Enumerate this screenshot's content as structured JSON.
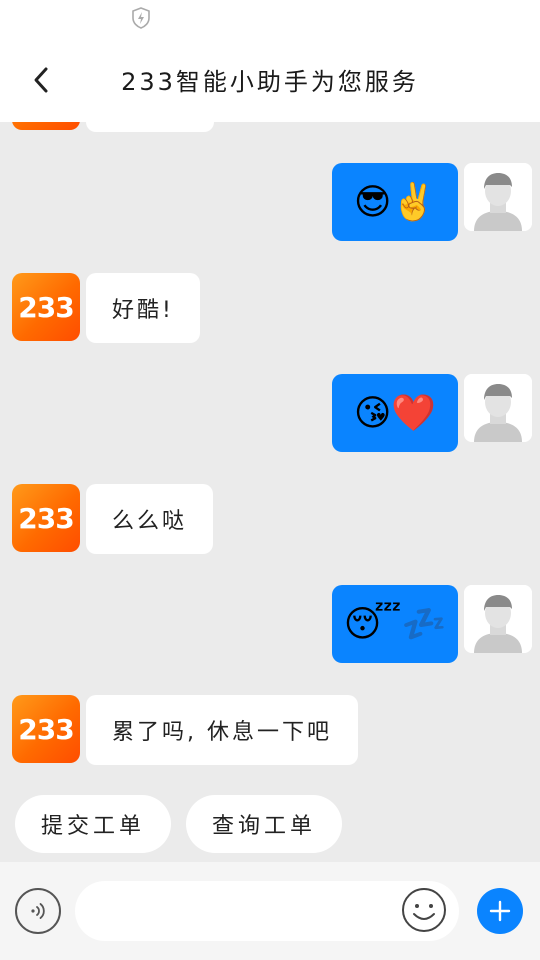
{
  "status_bar": {
    "icon": "shield-bolt-icon"
  },
  "header": {
    "back_icon": "chevron-left-icon",
    "title": "233智能小助手为您服务"
  },
  "bot": {
    "avatar_text": "233",
    "avatar_colors": [
      "#ff9a1a",
      "#ff4d00"
    ]
  },
  "messages": [
    {
      "from": "user",
      "content": "😎✌️"
    },
    {
      "from": "bot",
      "content": "好酷!"
    },
    {
      "from": "user",
      "content": "😘❤️"
    },
    {
      "from": "bot",
      "content": "么么哒"
    },
    {
      "from": "user",
      "content": "😴💤"
    },
    {
      "from": "bot",
      "content": "累了吗, 休息一下吧"
    }
  ],
  "quick_actions": [
    "提交工单",
    "查询工单"
  ],
  "input_bar": {
    "voice_icon": "voice-icon",
    "placeholder": "",
    "emoji_icon": "smiley-icon",
    "add_icon": "plus-icon"
  },
  "colors": {
    "accent": "#0a84ff",
    "background": "#ebebeb",
    "bubble_bot": "#ffffff"
  }
}
